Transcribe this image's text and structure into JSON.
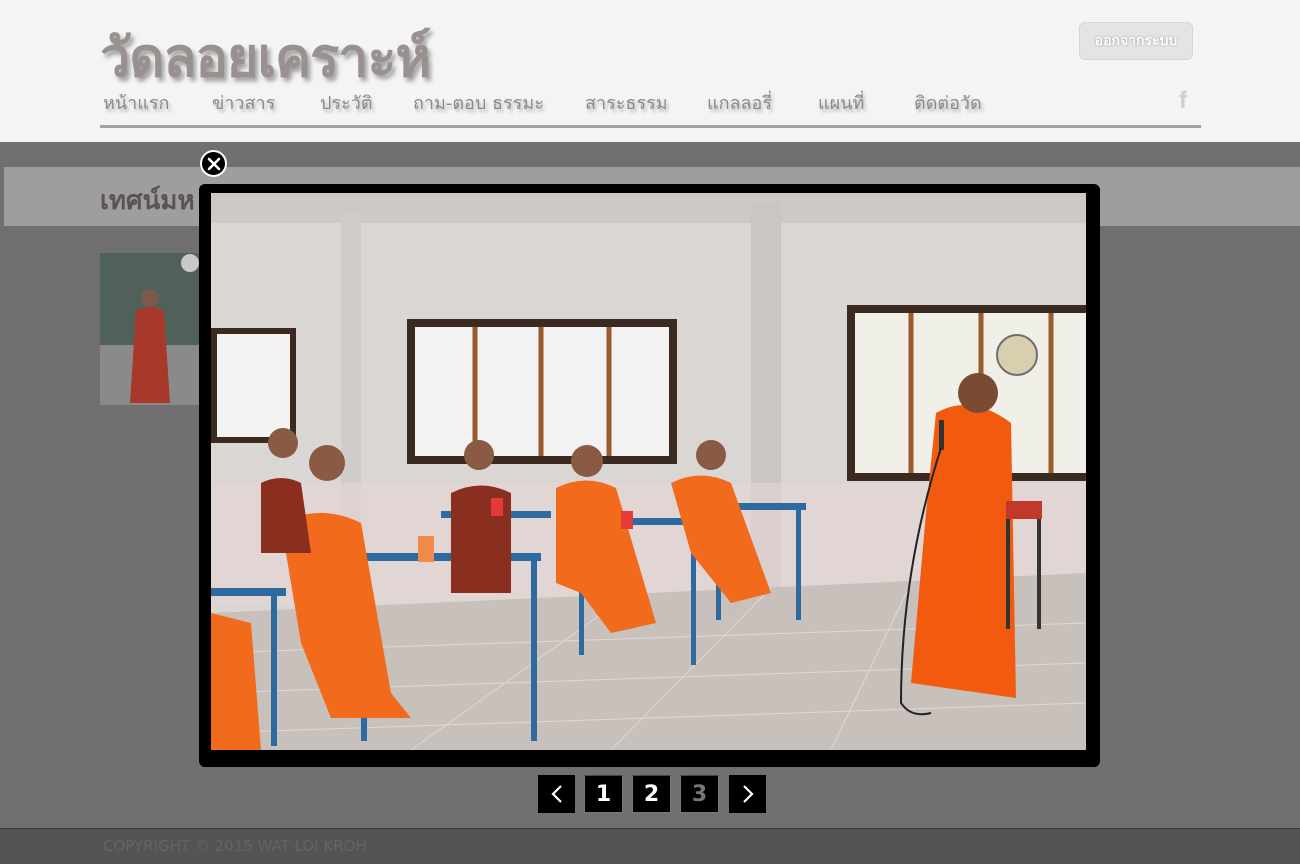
{
  "site": {
    "title": "วัดลอยเคราะห์",
    "logout_label": "ออกจากระบบ",
    "facebook_icon": "facebook-icon"
  },
  "nav": {
    "items": [
      {
        "label": "หน้าแรก"
      },
      {
        "label": "ข่าวสาร"
      },
      {
        "label": "ประวัติ"
      },
      {
        "label": "ถาม-ตอบ ธรรมะ"
      },
      {
        "label": "สาระธรรม"
      },
      {
        "label": "แกลลอรี่"
      },
      {
        "label": "แผนที่"
      },
      {
        "label": "ติดต่อวัด"
      }
    ]
  },
  "page": {
    "banner_title": "เทศน์มห"
  },
  "lightbox": {
    "close_icon": "close-icon",
    "prev_icon": "chevron-left-icon",
    "next_icon": "chevron-right-icon",
    "pages": [
      "1",
      "2",
      "3"
    ],
    "current_page": "3"
  },
  "footer": {
    "copyright": "COPYRIGHT © 2015 WAT LOI KROH"
  },
  "colors": {
    "robe": "#f26a1b",
    "overlay": "#707070",
    "lightbox_frame": "#000000"
  }
}
